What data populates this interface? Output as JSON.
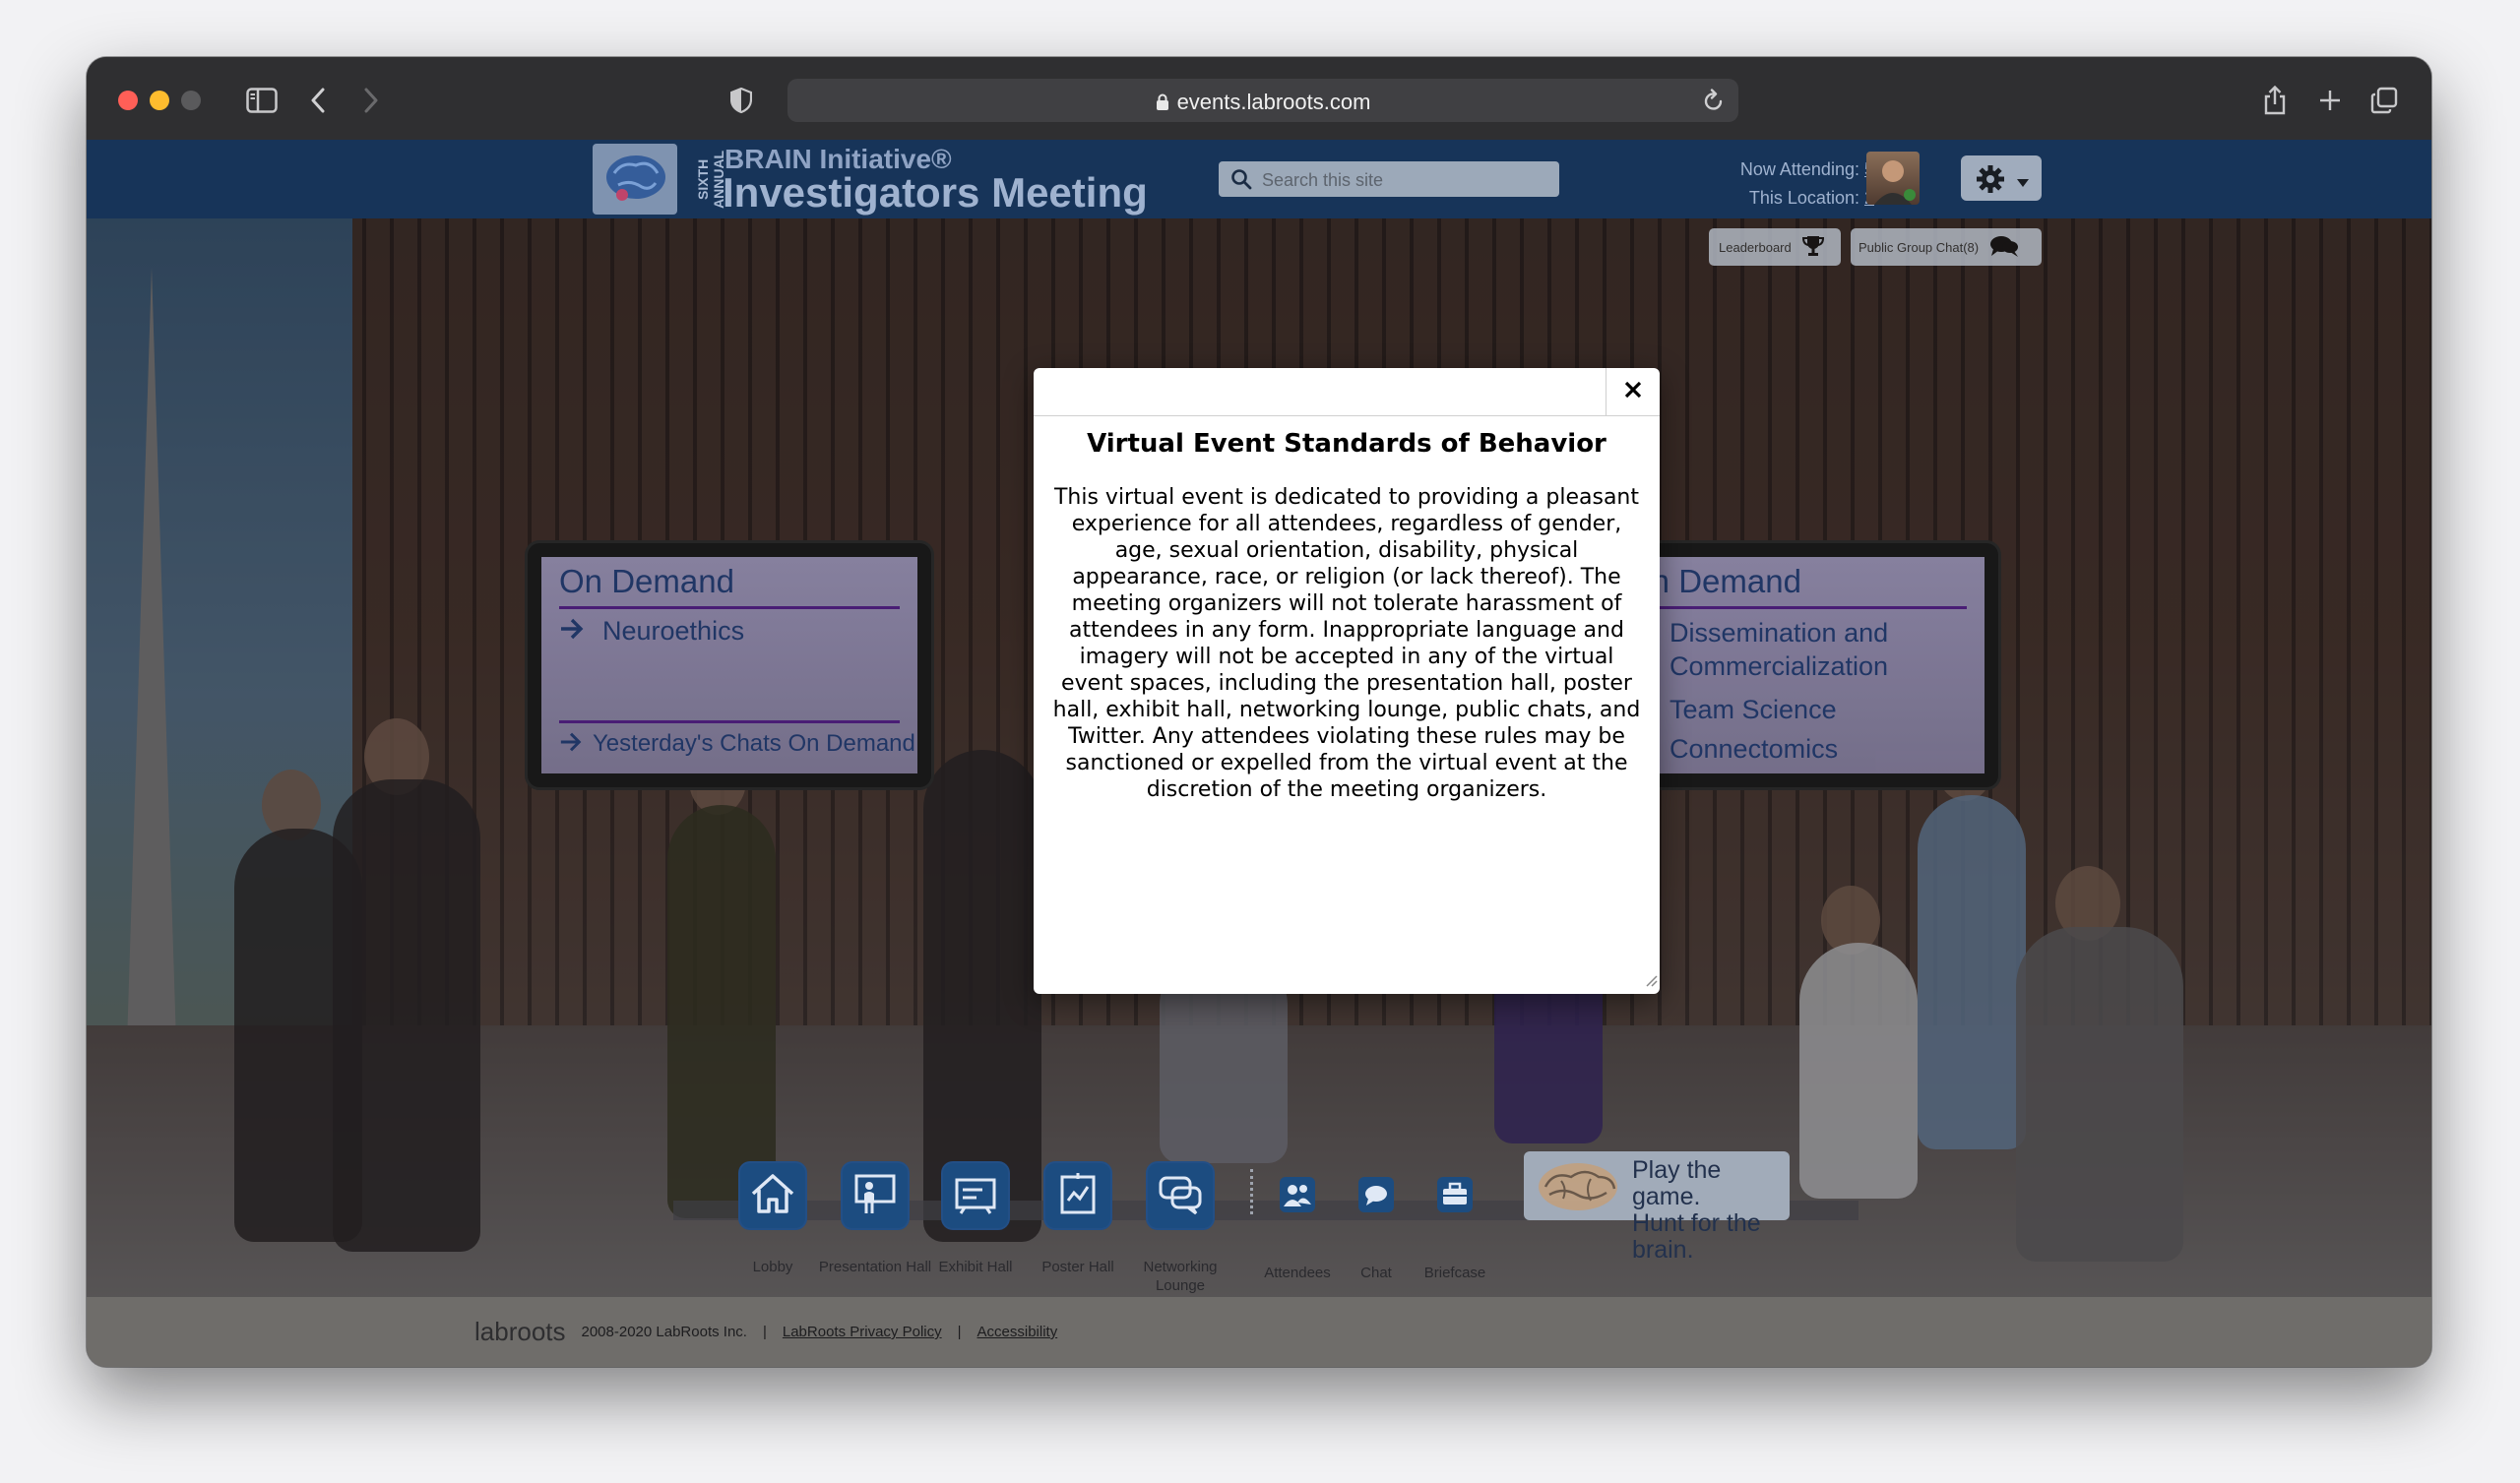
{
  "browser": {
    "url": "events.labroots.com"
  },
  "header": {
    "logo_vertical_text": "SIXTH ANNUAL",
    "title_line1": "BRAIN Initiative®",
    "title_line2": "Investigators Meeting",
    "search_placeholder": "Search this site",
    "now_attending_label": "Now Attending:",
    "now_attending_count": "5",
    "this_location_label": "This Location:",
    "this_location_count": "2",
    "leaderboard_label": "Leaderboard",
    "public_chat_label": "Public Group Chat(8)"
  },
  "screens": {
    "left": {
      "title": "On Demand",
      "items": [
        "Neuroethics"
      ],
      "footer_item": "Yesterday's Chats On Demand"
    },
    "right": {
      "title": "On Demand",
      "items": [
        "Dissemination and Commercialization",
        "Team Science",
        "Connectomics"
      ]
    }
  },
  "modal": {
    "title": "Virtual Event Standards of Behavior",
    "body": "This virtual event is dedicated to providing a pleasant experience for all attendees, regardless of gender, age, sexual orientation, disability, physical appearance, race, or religion (or lack thereof). The meeting organizers will not tolerate harassment of attendees in any form. Inappropriate language and imagery will not be accepted in any of the virtual event spaces, including the presentation hall, poster hall, exhibit hall, networking lounge, public chats, and Twitter. Any attendees violating these rules may be sanctioned or expelled from the virtual event at the discretion of the meeting organizers.",
    "close_glyph": "×"
  },
  "dock": {
    "items": [
      {
        "label": "Lobby",
        "icon": "home-icon"
      },
      {
        "label": "Presentation Hall",
        "icon": "presentation-icon"
      },
      {
        "label": "Exhibit Hall",
        "icon": "exhibit-icon"
      },
      {
        "label": "Poster Hall",
        "icon": "poster-icon"
      },
      {
        "label": "Networking Lounge",
        "icon": "chat-bubbles-icon"
      },
      {
        "label": "Attendees",
        "icon": "attendees-icon"
      },
      {
        "label": "Chat",
        "icon": "chat-icon"
      },
      {
        "label": "Briefcase",
        "icon": "briefcase-icon"
      }
    ]
  },
  "game": {
    "line1": "Play the game.",
    "line2": "Hunt for the brain."
  },
  "footer": {
    "logo": "labroots",
    "copyright": "2008-2020 LabRoots Inc.",
    "separator": "|",
    "privacy_link": "LabRoots Privacy Policy",
    "accessibility_link": "Accessibility"
  },
  "colors": {
    "header_bg": "#173459",
    "dock_icon_bg": "#1c4c80",
    "screen_title": "#21386a",
    "screen_rule": "#4c1e7a"
  }
}
